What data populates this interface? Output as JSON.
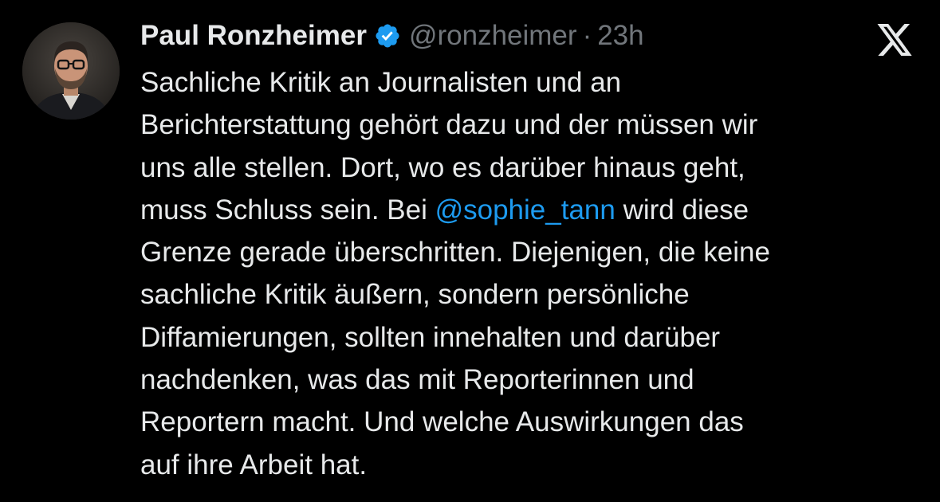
{
  "author": {
    "display_name": "Paul Ronzheimer",
    "handle": "@ronzheimer",
    "separator": "·",
    "timestamp": "23h",
    "verified_icon": "verified-badge-icon",
    "avatar": "avatar-photo"
  },
  "platform_icon": "x-logo-icon",
  "colors": {
    "background": "#000000",
    "text": "#e7e9ea",
    "secondary": "#71767b",
    "accent": "#1d9bf0"
  },
  "tweet": {
    "lines": [
      "Sachliche Kritik an Journalisten und an",
      "Berichterstattung gehört dazu und der müssen wir",
      "uns alle stellen. Dort, wo es darüber hinaus geht,",
      {
        "before": "muss Schluss sein. Bei ",
        "mention": "@sophie_tann",
        "after": " wird diese"
      },
      "Grenze gerade überschritten. Diejenigen, die keine",
      "sachliche Kritik äußern, sondern persönliche",
      "Diffamierungen, sollten innehalten und darüber",
      "nachdenken, was das mit Reporterinnen und",
      "Reportern macht. Und welche Auswirkungen das",
      "auf ihre Arbeit hat."
    ]
  }
}
